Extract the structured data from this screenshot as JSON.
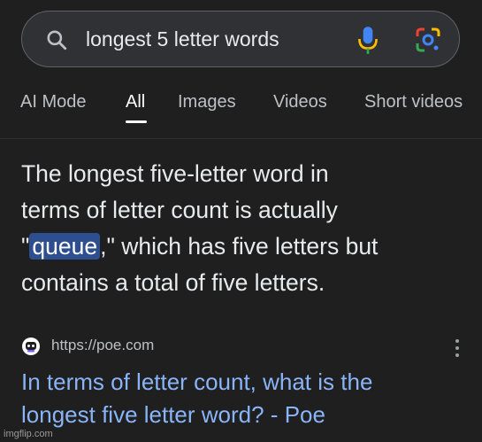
{
  "search": {
    "query": "longest 5 letter words"
  },
  "tabs": [
    {
      "label": "AI Mode"
    },
    {
      "label": "All"
    },
    {
      "label": "Images"
    },
    {
      "label": "Videos"
    },
    {
      "label": "Short videos"
    }
  ],
  "active_tab": "All",
  "answer": {
    "line1": "The longest five-letter word in",
    "line2": "terms of letter count is actually",
    "line3_before": "\"",
    "highlight": "queue",
    "line3_after": ",\" which has five letters but",
    "line4": "contains a total of five letters."
  },
  "source": {
    "url": "https://poe.com",
    "title_line1": "In terms of letter count, what is the",
    "title_line2": "longest five letter word? - Poe"
  },
  "watermark": "imgflip.com",
  "colors": {
    "background": "#1f1f1f",
    "link": "#8ab4f8",
    "highlight": "#2d4f8f"
  },
  "icons": [
    "search-icon",
    "mic-icon",
    "google-lens-icon",
    "poe-icon",
    "more-vert-icon"
  ]
}
